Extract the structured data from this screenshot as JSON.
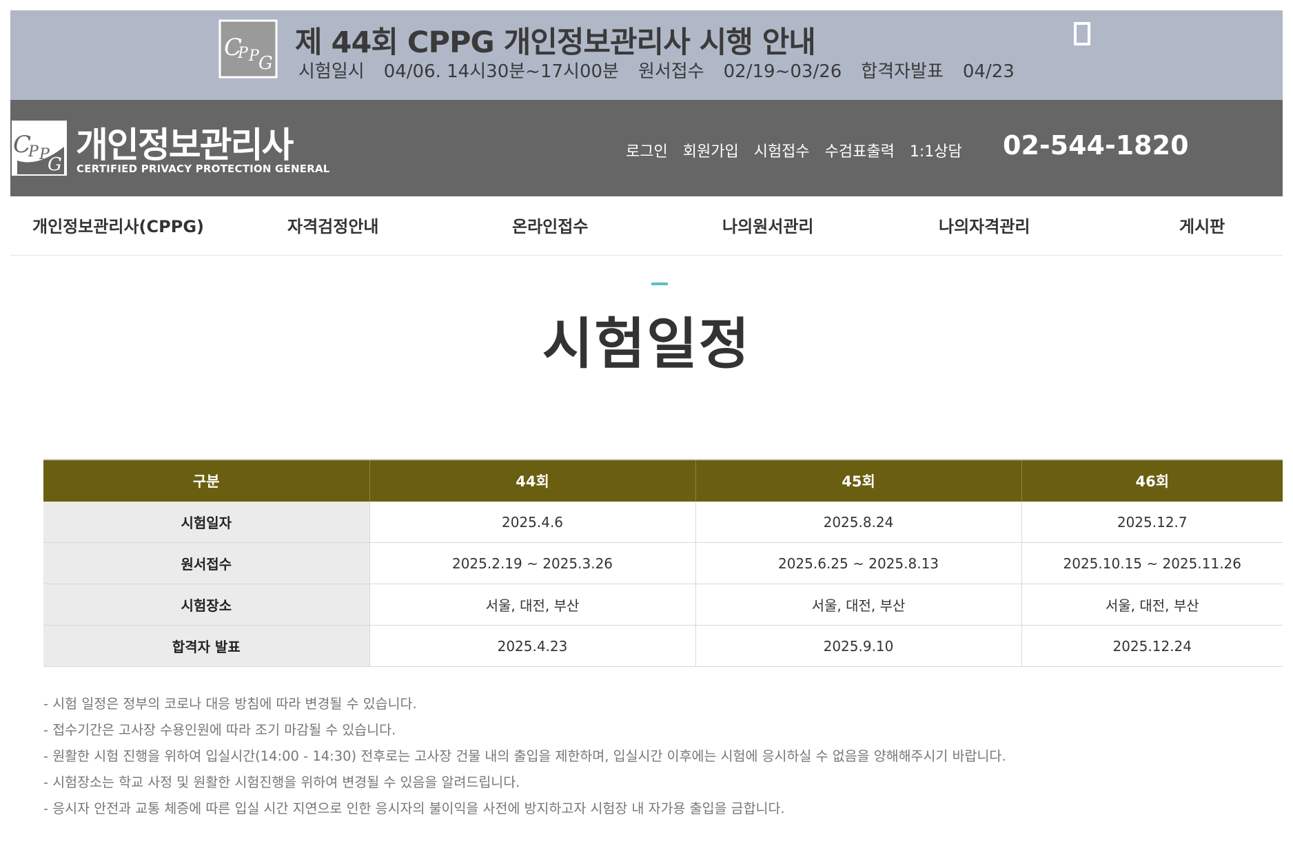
{
  "banner": {
    "logo_text": "CPPG",
    "title": "제 44회 CPPG 개인정보관리사 시행 안내",
    "exam_date_label": "시험일시",
    "exam_date_value": "04/06. 14시30분~17시00분",
    "application_label": "원서접수",
    "application_value": "02/19~03/26",
    "result_label": "합격자발표",
    "result_value": "04/23"
  },
  "header": {
    "logo_text": "CPPG",
    "brand": "개인정보관리사",
    "brand_sub": "CERTIFIED PRIVACY PROTECTION GENERAL",
    "links": [
      "로그인",
      "회원가입",
      "시험접수",
      "수검표출력",
      "1:1상담"
    ],
    "phone": "02-544-1820"
  },
  "nav": {
    "items": [
      "개인정보관리사(CPPG)",
      "자격검정안내",
      "온라인접수",
      "나의원서관리",
      "나의자격관리",
      "게시판"
    ]
  },
  "page": {
    "title": "시험일정"
  },
  "schedule": {
    "headers": [
      "구분",
      "44회",
      "45회",
      "46회"
    ],
    "rows": [
      {
        "label": "시험일자",
        "cells": [
          "2025.4.6",
          "2025.8.24",
          "2025.12.7"
        ]
      },
      {
        "label": "원서접수",
        "cells": [
          "2025.2.19 ~ 2025.3.26",
          "2025.6.25 ~ 2025.8.13",
          "2025.10.15 ~ 2025.11.26"
        ]
      },
      {
        "label": "시험장소",
        "cells": [
          "서울, 대전, 부산",
          "서울, 대전, 부산",
          "서울, 대전, 부산"
        ]
      },
      {
        "label": "합격자 발표",
        "cells": [
          "2025.4.23",
          "2025.9.10",
          "2025.12.24"
        ]
      }
    ]
  },
  "notes": [
    "- 시험 일정은 정부의 코로나 대응 방침에 따라 변경될 수 있습니다.",
    "- 접수기간은 고사장 수용인원에 따라 조기 마감될 수 있습니다.",
    "- 원활한 시험 진행을 위하여 입실시간(14:00 - 14:30) 전후로는 고사장 건물 내의 출입을 제한하며, 입실시간 이후에는 시험에 응시하실 수 없음을 양해해주시기 바랍니다.",
    "- 시험장소는 학교 사정 및 원활한 시험진행을 위하여 변경될 수 있음을 알려드립니다.",
    "- 응시자 안전과 교통 체증에 따른 입실 시간 지연으로 인한 응시자의 불이익을 사전에 방지하고자 시험장 내 자가용 출입을 금합니다."
  ],
  "colors": {
    "banner_bg": "#b0b8c8",
    "header_bg": "#666666",
    "table_header_bg": "#6a5e10",
    "accent": "#5bbfbf"
  }
}
